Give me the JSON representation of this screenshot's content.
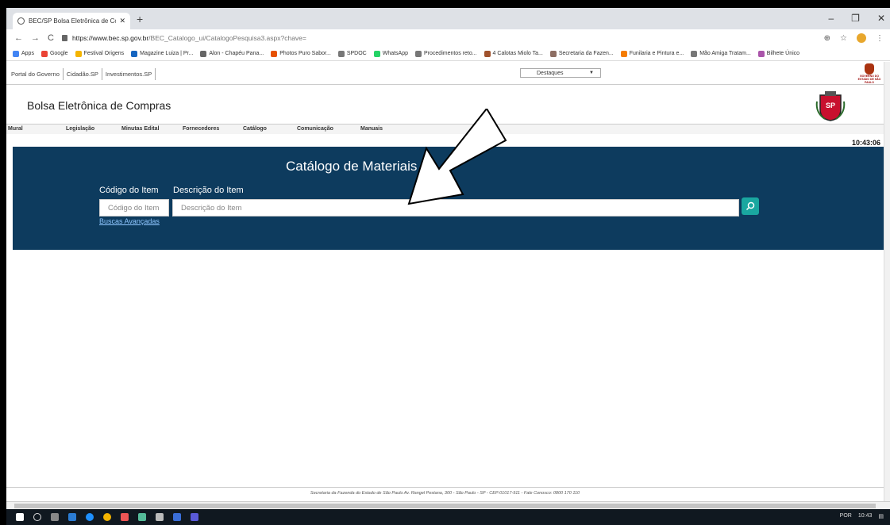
{
  "browser": {
    "tab_title": "BEC/SP Bolsa Eletrônica de Comp",
    "url_host": "https://www.bec.sp.gov.br",
    "url_path": "/BEC_Catalogo_ui/CatalogoPesquisa3.aspx?chave=",
    "bookmarks": [
      "Apps",
      "Google",
      "Festival Origens",
      "Magazine Luiza | Pr...",
      "Alon - Chapéu Pana...",
      "Photos Puro Sabor...",
      "SPDOC",
      "WhatsApp",
      "Procedimentos reto...",
      "4 Calotas Miolo Ta...",
      "Secretaria da Fazen...",
      "Funilaria e Pintura e...",
      "Mão Amiga Tratam...",
      "Bilhete Único"
    ]
  },
  "gov_bar": {
    "links": [
      "Portal do Governo",
      "Cidadão.SP",
      "Investimentos.SP"
    ],
    "destaques": "Destaques",
    "logo_text": "GOVERNO DO ESTADO DE SÃO PAULO"
  },
  "header": {
    "title": "Bolsa Eletrônica de Compras"
  },
  "menu": [
    "Mural",
    "Legislação",
    "Minutas Edital",
    "Fornecedores",
    "Catálogo",
    "Comunicação",
    "Manuais"
  ],
  "clock": "10:43:06",
  "catalog": {
    "title": "Catálogo de Materiais",
    "code_label": "Código do Item",
    "desc_label": "Descrição do Item",
    "code_placeholder": "Código do Item",
    "desc_placeholder": "Descrição do Item",
    "advanced_link": "Buscas Avançadas"
  },
  "footer": "Secretaria da Fazenda do Estado de São Paulo Av. Rangel Pestana, 300 - São Paulo - SP - CEP:01017-911 - Fale Conosco: 0800 170 110",
  "taskbar": {
    "tray": "POR",
    "time": "10:43"
  }
}
